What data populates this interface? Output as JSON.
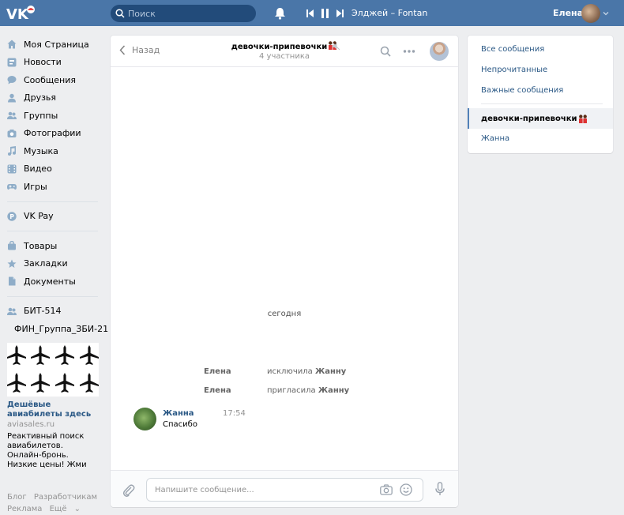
{
  "header": {
    "search_placeholder": "Поиск",
    "track": "Элджей – Fontan",
    "user_name": "Елена"
  },
  "sidebar": {
    "items": [
      {
        "label": "Моя Страница",
        "icon": "home-icon"
      },
      {
        "label": "Новости",
        "icon": "news-icon"
      },
      {
        "label": "Сообщения",
        "icon": "messages-icon"
      },
      {
        "label": "Друзья",
        "icon": "friends-icon"
      },
      {
        "label": "Группы",
        "icon": "groups-icon"
      },
      {
        "label": "Фотографии",
        "icon": "camera-icon"
      },
      {
        "label": "Музыка",
        "icon": "music-icon"
      },
      {
        "label": "Видео",
        "icon": "video-icon"
      },
      {
        "label": "Игры",
        "icon": "games-icon"
      }
    ],
    "pay": {
      "label": "VK Pay",
      "icon": "vkpay-icon"
    },
    "items2": [
      {
        "label": "Товары",
        "icon": "bag-icon"
      },
      {
        "label": "Закладки",
        "icon": "star-icon"
      },
      {
        "label": "Документы",
        "icon": "document-icon"
      }
    ],
    "groups": [
      {
        "label": "БИТ-514",
        "icon": "group-icon"
      },
      {
        "label": "ФИН_Группа_ЗБИ-21",
        "icon": "group-icon"
      }
    ],
    "ad": {
      "title": "Дешёвые авиабилеты здесь",
      "domain": "aviasales.ru",
      "text": "Реактивный поиск авиабилетов. Онлайн-бронь. Низкие цены! Жми"
    },
    "footer": {
      "blog": "Блог",
      "developers": "Разработчикам",
      "ads": "Реклама",
      "more": "Ещё"
    }
  },
  "chat": {
    "back_label": "Назад",
    "title": "девочки-припевочки",
    "subtitle": "4 участника",
    "day_separator": "сегодня",
    "service": [
      {
        "who": "Елена",
        "action": "исключила",
        "target": "Жанну"
      },
      {
        "who": "Елена",
        "action": "пригласила",
        "target": "Жанну"
      }
    ],
    "message": {
      "author": "Жанна",
      "time": "17:54",
      "text": "Спасибо"
    },
    "composer_placeholder": "Напишите сообщение..."
  },
  "right_panel": {
    "filters": [
      "Все сообщения",
      "Непрочитанные",
      "Важные сообщения"
    ],
    "dialogs": [
      "девочки-припевочки",
      "Жанна"
    ]
  },
  "colors": {
    "header": "#4a76a8",
    "link": "#2a5885",
    "accent": "#5181b8",
    "background": "#edeef0"
  }
}
